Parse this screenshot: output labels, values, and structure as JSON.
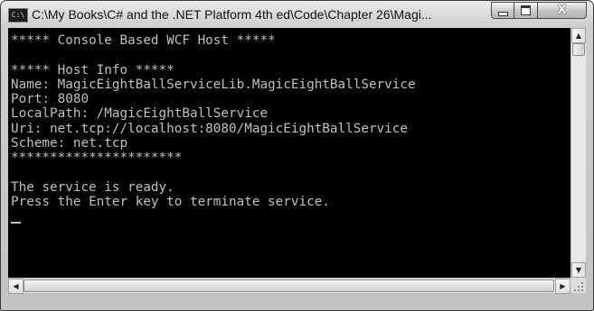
{
  "window": {
    "title": "C:\\My Books\\C# and the .NET Platform 4th ed\\Code\\Chapter 26\\Magi...",
    "icon_label": "C:\\",
    "icon": "console-app-icon",
    "minimize_icon": "minimize-icon",
    "maximize_icon": "maximize-icon",
    "close_glyph": "X"
  },
  "console": {
    "lines": [
      "***** Console Based WCF Host *****",
      "",
      "***** Host Info *****",
      "Name: MagicEightBallServiceLib.MagicEightBallService",
      "Port: 8080",
      "LocalPath: /MagicEightBallService",
      "Uri: net.tcp://localhost:8080/MagicEightBallService",
      "Scheme: net.tcp",
      "**********************",
      "",
      "The service is ready.",
      "Press the Enter key to terminate service."
    ],
    "text_color": "#c0c0c0",
    "background": "#000000"
  },
  "scrollbars": {
    "up_arrow": "▲",
    "down_arrow": "▼",
    "left_arrow": "◀",
    "right_arrow": "▶"
  }
}
